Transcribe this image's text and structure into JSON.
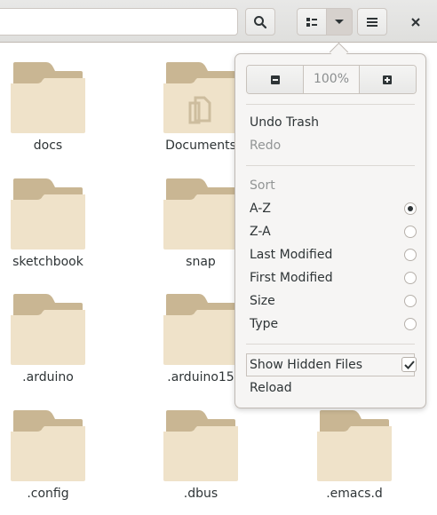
{
  "header": {
    "search_icon": "search-icon",
    "view_icon": "list-view-icon",
    "dropdown_icon": "chevron-down-icon",
    "menu_icon": "hamburger-menu-icon",
    "close_icon": "close-icon"
  },
  "files": [
    {
      "name": "docs",
      "icon": "folder-icon"
    },
    {
      "name": "Documents",
      "icon": "documents-folder-icon"
    },
    {
      "name": "sketchbook",
      "icon": "folder-icon"
    },
    {
      "name": "snap",
      "icon": "folder-icon"
    },
    {
      "name": ".arduino",
      "icon": "folder-icon"
    },
    {
      "name": ".arduino15",
      "icon": "folder-icon"
    },
    {
      "name": ".config",
      "icon": "folder-icon"
    },
    {
      "name": ".dbus",
      "icon": "folder-icon"
    },
    {
      "name": ".emacs.d",
      "icon": "folder-icon"
    }
  ],
  "popover": {
    "zoom_out_icon": "minus-icon",
    "zoom_level": "100%",
    "zoom_in_icon": "plus-icon",
    "undo_label": "Undo Trash",
    "redo_label": "Redo",
    "sort_heading": "Sort",
    "sort_options": [
      {
        "label": "A-Z",
        "checked": true
      },
      {
        "label": "Z-A",
        "checked": false
      },
      {
        "label": "Last Modified",
        "checked": false
      },
      {
        "label": "First Modified",
        "checked": false
      },
      {
        "label": "Size",
        "checked": false
      },
      {
        "label": "Type",
        "checked": false
      }
    ],
    "show_hidden_label": "Show Hidden Files",
    "show_hidden_checked": true,
    "reload_label": "Reload"
  },
  "colors": {
    "folder_body": "#efe2c9",
    "folder_tab": "#c9b693",
    "popover_bg": "#f6f5f4",
    "text": "#2e3436"
  }
}
